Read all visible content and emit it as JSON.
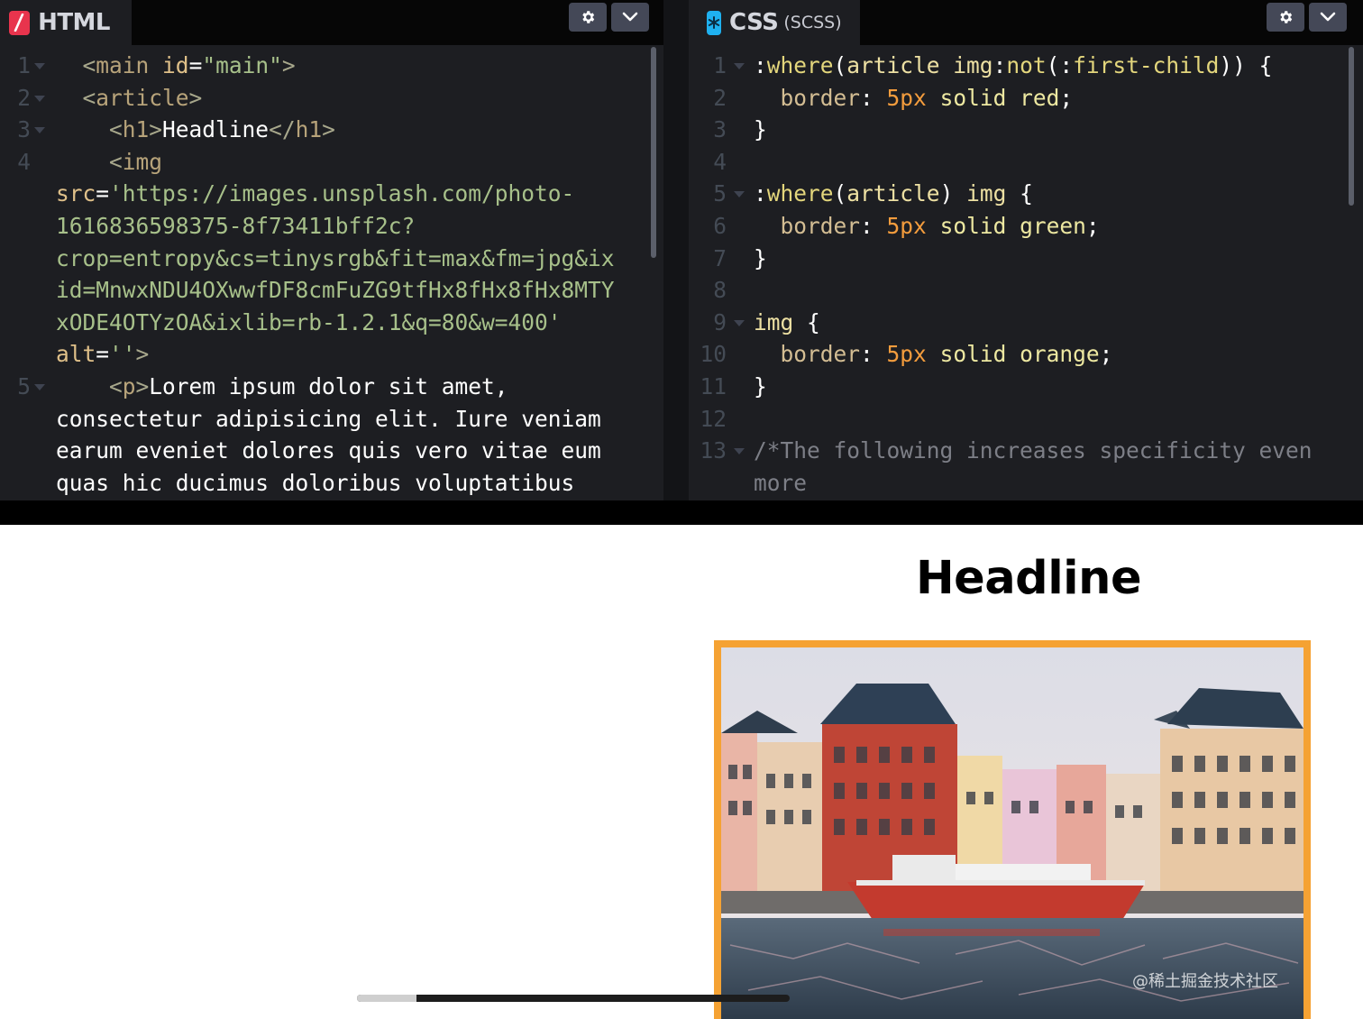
{
  "html_editor": {
    "tab_title": "HTML",
    "lines": [
      {
        "n": "1",
        "fold": true,
        "tokens": [
          [
            "  ",
            ""
          ],
          [
            "<",
            "t-tag"
          ],
          [
            "main",
            "t-tagname"
          ],
          [
            " id",
            "t-attr"
          ],
          [
            "=",
            "t-punc"
          ],
          [
            "\"main\"",
            "t-str"
          ],
          [
            ">",
            "t-tag"
          ]
        ],
        "indent": 0
      },
      {
        "n": "2",
        "fold": true,
        "tokens": [
          [
            "  <",
            "t-tag"
          ],
          [
            "article",
            "t-tagname"
          ],
          [
            ">",
            "t-tag"
          ]
        ],
        "indent": 1
      },
      {
        "n": "3",
        "fold": true,
        "tokens": [
          [
            "    <",
            "t-tag"
          ],
          [
            "h1",
            "t-tagname"
          ],
          [
            ">",
            "t-tag"
          ],
          [
            "Headline",
            "t-text"
          ],
          [
            "</",
            "t-tag"
          ],
          [
            "h1",
            "t-tagname"
          ],
          [
            ">",
            "t-tag"
          ]
        ],
        "indent": 2
      },
      {
        "n": "4",
        "fold": false,
        "tokens": [
          [
            "    <",
            "t-tag"
          ],
          [
            "img",
            "t-tagname"
          ]
        ],
        "indent": 2
      },
      {
        "n": "",
        "fold": false,
        "tokens": [
          [
            "src",
            "t-attr"
          ],
          [
            "=",
            "t-punc"
          ],
          [
            "'https://images.unsplash.com/photo-",
            "t-str"
          ]
        ],
        "indent": 0
      },
      {
        "n": "",
        "fold": false,
        "tokens": [
          [
            "1616836598375-8f73411bff2c?",
            "t-str"
          ]
        ],
        "indent": 0
      },
      {
        "n": "",
        "fold": false,
        "tokens": [
          [
            "crop=entropy&cs=tinysrgb&fit=max&fm=jpg&ix",
            "t-str"
          ]
        ],
        "indent": 0
      },
      {
        "n": "",
        "fold": false,
        "tokens": [
          [
            "id=MnwxNDU4OXwwfDF8cmFuZG9tfHx8fHx8fHx8MTY",
            "t-str"
          ]
        ],
        "indent": 0
      },
      {
        "n": "",
        "fold": false,
        "tokens": [
          [
            "xODE4OTYzOA&ixlib=rb-1.2.1&q=80&w=400'",
            "t-str"
          ]
        ],
        "indent": 0
      },
      {
        "n": "",
        "fold": false,
        "tokens": [
          [
            "alt",
            "t-attr"
          ],
          [
            "=",
            "t-punc"
          ],
          [
            "''",
            "t-str"
          ],
          [
            ">",
            "t-tag"
          ]
        ],
        "indent": 0
      },
      {
        "n": "5",
        "fold": true,
        "tokens": [
          [
            "    <",
            "t-tag"
          ],
          [
            "p",
            "t-tagname"
          ],
          [
            ">",
            "t-tag"
          ],
          [
            "Lorem ipsum dolor sit amet,",
            "t-text"
          ]
        ],
        "indent": 2
      },
      {
        "n": "",
        "fold": false,
        "tokens": [
          [
            "consectetur adipisicing elit. Iure veniam",
            "t-text"
          ]
        ],
        "indent": 0
      },
      {
        "n": "",
        "fold": false,
        "tokens": [
          [
            "earum eveniet dolores quis vero vitae eum",
            "t-text"
          ]
        ],
        "indent": 0
      },
      {
        "n": "",
        "fold": false,
        "tokens": [
          [
            "quas hic ducimus doloribus voluptatibus",
            "t-text"
          ]
        ],
        "indent": 0
      }
    ]
  },
  "css_editor": {
    "tab_title": "CSS",
    "tab_subtitle": "(SCSS)",
    "lines": [
      {
        "n": "1",
        "fold": true,
        "tokens": [
          [
            ":",
            "t-punc"
          ],
          [
            "where",
            "t-pseudo"
          ],
          [
            "(",
            "t-punc"
          ],
          [
            "article img",
            "t-sel"
          ],
          [
            ":",
            "t-punc"
          ],
          [
            "not",
            "t-pseudo"
          ],
          [
            "(:",
            "t-punc"
          ],
          [
            "first-child",
            "t-pseudo"
          ],
          [
            ")) {",
            "t-punc"
          ]
        ]
      },
      {
        "n": "2",
        "fold": false,
        "tokens": [
          [
            "  ",
            ""
          ],
          [
            "border",
            "t-prop"
          ],
          [
            ": ",
            "t-punc"
          ],
          [
            "5px",
            "t-num"
          ],
          [
            " solid red",
            "t-val"
          ],
          [
            ";",
            "t-punc"
          ]
        ]
      },
      {
        "n": "3",
        "fold": false,
        "tokens": [
          [
            "}",
            "t-punc"
          ]
        ]
      },
      {
        "n": "4",
        "fold": false,
        "tokens": []
      },
      {
        "n": "5",
        "fold": true,
        "tokens": [
          [
            ":",
            "t-punc"
          ],
          [
            "where",
            "t-pseudo"
          ],
          [
            "(",
            "t-punc"
          ],
          [
            "article",
            "t-sel"
          ],
          [
            ") ",
            "t-punc"
          ],
          [
            "img",
            "t-sel"
          ],
          [
            " {",
            "t-punc"
          ]
        ]
      },
      {
        "n": "6",
        "fold": false,
        "tokens": [
          [
            "  ",
            ""
          ],
          [
            "border",
            "t-prop"
          ],
          [
            ": ",
            "t-punc"
          ],
          [
            "5px",
            "t-num"
          ],
          [
            " solid green",
            "t-val"
          ],
          [
            ";",
            "t-punc"
          ]
        ]
      },
      {
        "n": "7",
        "fold": false,
        "tokens": [
          [
            "}",
            "t-punc"
          ]
        ]
      },
      {
        "n": "8",
        "fold": false,
        "tokens": []
      },
      {
        "n": "9",
        "fold": true,
        "tokens": [
          [
            "img",
            "t-sel"
          ],
          [
            " {",
            "t-punc"
          ]
        ]
      },
      {
        "n": "10",
        "fold": false,
        "tokens": [
          [
            "  ",
            ""
          ],
          [
            "border",
            "t-prop"
          ],
          [
            ": ",
            "t-punc"
          ],
          [
            "5px",
            "t-num"
          ],
          [
            " solid orange",
            "t-val"
          ],
          [
            ";",
            "t-punc"
          ]
        ]
      },
      {
        "n": "11",
        "fold": false,
        "tokens": [
          [
            "}",
            "t-punc"
          ]
        ]
      },
      {
        "n": "12",
        "fold": false,
        "tokens": []
      },
      {
        "n": "13",
        "fold": true,
        "tokens": [
          [
            "/*The following increases specificity even",
            "t-com"
          ]
        ]
      },
      {
        "n": "",
        "fold": false,
        "tokens": [
          [
            "more",
            "t-com"
          ]
        ]
      }
    ]
  },
  "preview": {
    "headline": "Headline",
    "image_border_color": "#f5a233",
    "image_description": "colorful harbor houses with red boat",
    "watermark": "@稀土掘金技术社区"
  },
  "colors": {
    "html_badge": "#e8344d",
    "css_badge": "#1fb1f0",
    "editor_bg": "#1d1e22"
  },
  "icons": {
    "settings": "gear-icon",
    "collapse": "chevron-down-icon"
  }
}
